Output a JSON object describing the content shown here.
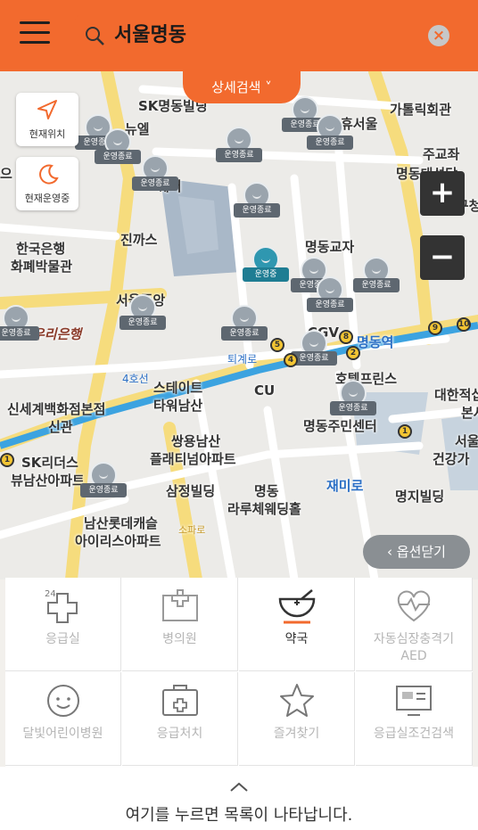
{
  "search": {
    "value": "서울명동"
  },
  "detail_search_label": "상세검색",
  "side_buttons": [
    {
      "label": "현재위치"
    },
    {
      "label": "현재운영중"
    }
  ],
  "map": {
    "labels": [
      "SK명동빌딩",
      "가톨릭회관",
      "휴서울",
      "주교좌",
      "명동대성당",
      "교구청",
      "퀘어",
      "진까스",
      "한국은행",
      "화폐박물관",
      "서울중앙",
      "명동교자",
      "우리은행",
      "CGV",
      "명동역",
      "퇴계로",
      "4호선",
      "스테이트",
      "타워남산",
      "CU",
      "호텔프린스",
      "대한적십자사",
      "본사",
      "신세계백화점본점",
      "신관",
      "명동주민센터",
      "서울",
      "건강가",
      "SK리더스",
      "뷰남산아파트",
      "쌍용남산",
      "플래티넘아파트",
      "삼정빌딩",
      "명동",
      "라루체웨딩홀",
      "재미로",
      "명지빌딩",
      "남산롯데캐슬",
      "아이리스아파트",
      "소파로",
      "뉴엘",
      "으"
    ],
    "marker_closed": "운영종료",
    "marker_open": "운영중",
    "station_numbers": [
      "5",
      "4",
      "8",
      "2",
      "9",
      "10",
      "1",
      "1"
    ]
  },
  "zoom": {
    "in": "+",
    "out": "−"
  },
  "close_options_label": "옵션닫기",
  "categories": [
    {
      "label": "응급실",
      "icon": "emergency-24-icon"
    },
    {
      "label": "병의원",
      "icon": "hospital-icon"
    },
    {
      "label": "약국",
      "icon": "pharmacy-icon"
    },
    {
      "label": "자동심장충격기 AED",
      "icon": "aed-heart-icon"
    },
    {
      "label": "달빛어린이병원",
      "icon": "child-face-icon"
    },
    {
      "label": "응급처치",
      "icon": "first-aid-kit-icon"
    },
    {
      "label": "즐겨찾기",
      "icon": "star-icon"
    },
    {
      "label": "응급실조건검색",
      "icon": "monitor-icon"
    }
  ],
  "footer": {
    "message": "여기를 누르면 목록이 나타납니다."
  },
  "colors": {
    "accent": "#f26a2e",
    "subway_line4": "#3ca3e0"
  }
}
